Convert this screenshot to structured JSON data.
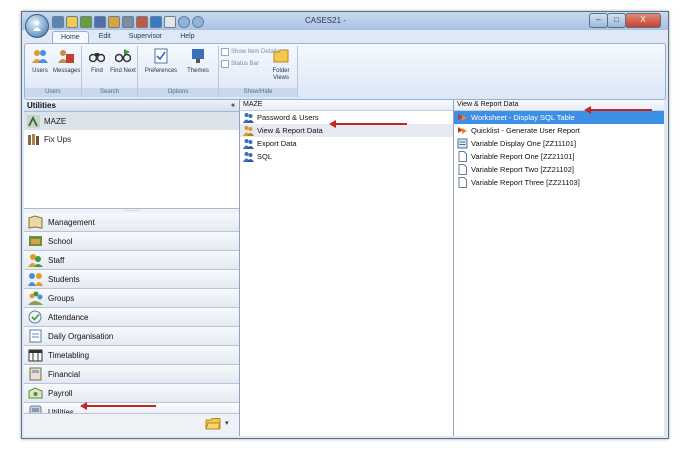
{
  "window": {
    "title": "CASES21 -",
    "buttons": {
      "minimize": "–",
      "maximize": "□",
      "close": "X"
    }
  },
  "ribbon": {
    "tabs": [
      {
        "label": "Home"
      },
      {
        "label": "Edit"
      },
      {
        "label": "Supervisor"
      },
      {
        "label": "Help"
      }
    ],
    "groups": {
      "users": {
        "label": "Users",
        "buttons": [
          {
            "label": "Users",
            "icon": "users-icon"
          },
          {
            "label": "Messages",
            "icon": "messages-icon"
          }
        ]
      },
      "search": {
        "label": "Search",
        "buttons": [
          {
            "label": "Find",
            "icon": "binoculars-icon"
          },
          {
            "label": "Find Next",
            "icon": "binoculars-next-icon"
          }
        ]
      },
      "options": {
        "label": "Options",
        "buttons": [
          {
            "label": "Preferences",
            "icon": "preferences-icon"
          },
          {
            "label": "Themes",
            "icon": "themes-icon"
          }
        ]
      },
      "showhide": {
        "label": "Show/Hide",
        "checkboxes": [
          "Show Item Details",
          "Status Bar"
        ],
        "folder_button": "Folder Views"
      }
    }
  },
  "utilities_panel": {
    "title": "Utilities",
    "collapse_glyph": "«",
    "items": [
      {
        "label": "MAZE",
        "icon": "maze-icon"
      },
      {
        "label": "Fix Ups",
        "icon": "fixups-icon"
      }
    ]
  },
  "nav": {
    "items": [
      {
        "label": "Management",
        "icon": "management-icon"
      },
      {
        "label": "School",
        "icon": "school-icon"
      },
      {
        "label": "Staff",
        "icon": "staff-icon"
      },
      {
        "label": "Students",
        "icon": "students-icon"
      },
      {
        "label": "Groups",
        "icon": "groups-icon"
      },
      {
        "label": "Attendance",
        "icon": "attendance-icon"
      },
      {
        "label": "Daily Organisation",
        "icon": "daily-organisation-icon"
      },
      {
        "label": "Timetabling",
        "icon": "timetabling-icon"
      },
      {
        "label": "Financial",
        "icon": "financial-icon"
      },
      {
        "label": "Payroll",
        "icon": "payroll-icon"
      },
      {
        "label": "Utilities",
        "icon": "utilities-icon"
      }
    ],
    "footer_arrow": "▾"
  },
  "maze_pane": {
    "header": "MAZE",
    "items": [
      {
        "label": "Password & Users"
      },
      {
        "label": "View & Report Data"
      },
      {
        "label": "Export Data"
      },
      {
        "label": "SQL"
      }
    ]
  },
  "report_pane": {
    "header": "View & Report Data",
    "items": [
      {
        "label": "Worksheet - Display SQL Table"
      },
      {
        "label": "Quicklist - Generate User Report"
      },
      {
        "label": "Variable Display One [ZZ11101]"
      },
      {
        "label": "Variable Report One [ZZ21101]"
      },
      {
        "label": "Variable Report Two [ZZ21102]"
      },
      {
        "label": "Variable Report Three [ZZ21103]"
      }
    ]
  },
  "colors": {
    "selection": "#3d8ee5",
    "arrow": "#c2261e",
    "ribbon_blue": "#dce7f5"
  }
}
